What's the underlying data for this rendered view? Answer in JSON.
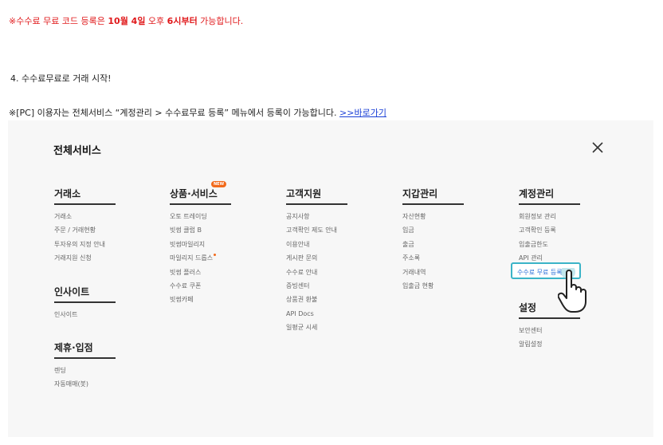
{
  "notice": {
    "prefix": "※수수료 무료 코드 등록은 ",
    "date": "10월 4일",
    "mid": " 오후 ",
    "time": "6시부터",
    "suffix": " 가능합니다."
  },
  "step": "4. 수수료무료로 거래 시작!",
  "note": {
    "text": "※[PC] 이용자는 전체서비스 “계정관리 > 수수료무료 등록” 메뉴에서 등록이 가능합니다. ",
    "link": ">>바로가기"
  },
  "panel": {
    "title": "전체서비스",
    "close_icon": "close-icon",
    "columns": [
      {
        "heading": "거래소",
        "items": [
          "거래소",
          "주문 / 거래현황",
          "투자유의 지정 안내",
          "거래지원 신청"
        ],
        "sub": [
          {
            "heading": "인사이트",
            "items": [
              "인사이트"
            ]
          },
          {
            "heading": "제휴·입점",
            "items": [
              "렌딩",
              "자동매매(봇)"
            ]
          }
        ]
      },
      {
        "heading": "상품·서비스",
        "badge": "NEW",
        "items": [
          "오토 트레이딩",
          "빗썸 클럽 B",
          "빗썸마일리지",
          "마일리지 드롭스",
          "빗썸 플러스",
          "수수료 쿠폰",
          "빗썸카페"
        ]
      },
      {
        "heading": "고객지원",
        "items": [
          "공지사항",
          "고객확인 제도 안내",
          "이용안내",
          "게시판 문의",
          "수수료 안내",
          "증빙센터",
          "상품권 환불",
          "API Docs",
          "일평균 시세"
        ]
      },
      {
        "heading": "지갑관리",
        "items": [
          "자산현황",
          "입금",
          "출금",
          "주소록",
          "거래내역",
          "입출금 현황"
        ]
      },
      {
        "heading": "계정관리",
        "items": [
          "회원정보 관리",
          "고객확인 등록",
          "입출금한도",
          "API 관리"
        ],
        "highlight": "수수료 무료 등록",
        "sub": [
          {
            "heading": "설정",
            "items": [
              "보안센터",
              "알림설정"
            ]
          }
        ]
      }
    ]
  },
  "colors": {
    "accent_red": "#e0191b",
    "link_blue": "#1a3fd6",
    "highlight_border": "#3bb4c8",
    "badge_orange": "#f26a1b"
  }
}
